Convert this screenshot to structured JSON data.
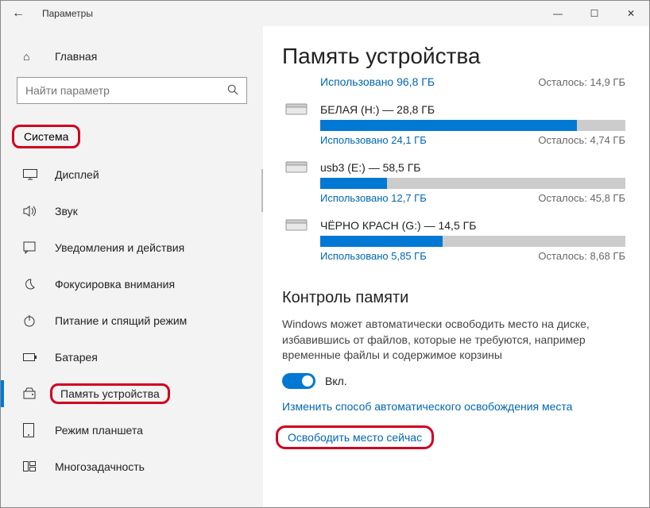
{
  "window": {
    "title": "Параметры"
  },
  "sidebar": {
    "home": "Главная",
    "search_placeholder": "Найти параметр",
    "section": "Система",
    "items": [
      {
        "label": "Дисплей"
      },
      {
        "label": "Звук"
      },
      {
        "label": "Уведомления и действия"
      },
      {
        "label": "Фокусировка внимания"
      },
      {
        "label": "Питание и спящий режим"
      },
      {
        "label": "Батарея"
      },
      {
        "label": "Память устройства"
      },
      {
        "label": "Режим планшета"
      },
      {
        "label": "Многозадачность"
      }
    ]
  },
  "content": {
    "heading": "Память устройства",
    "overall_used": "Использовано 96,8 ГБ",
    "overall_remain": "Осталось: 14,9 ГБ",
    "drives": [
      {
        "name": "БЕЛАЯ (H:) — 28,8 ГБ",
        "used": "Использовано 24,1 ГБ",
        "remain": "Осталось: 4,74 ГБ",
        "fill": 84
      },
      {
        "name": "usb3 (E:) — 58,5 ГБ",
        "used": "Использовано 12,7 ГБ",
        "remain": "Осталось: 45,8 ГБ",
        "fill": 22
      },
      {
        "name": "ЧЁРНО КРАСН (G:) — 14,5 ГБ",
        "used": "Использовано 5,85 ГБ",
        "remain": "Осталось: 8,68 ГБ",
        "fill": 40
      }
    ],
    "sense_heading": "Контроль памяти",
    "sense_desc": "Windows может автоматически освободить место на диске, избавившись от файлов, которые не требуются, например временные файлы и содержимое корзины",
    "toggle_label": "Вкл.",
    "link_change": "Изменить способ автоматического освобождения места",
    "link_free": "Освободить место сейчас"
  }
}
